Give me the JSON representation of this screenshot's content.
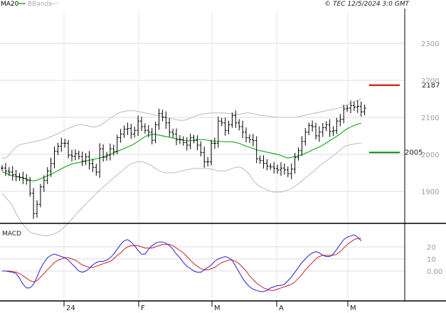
{
  "header": {
    "legend": [
      {
        "label": "MA20",
        "color": "#22aa22"
      },
      {
        "label": "BBands",
        "color": "#aaaaaa"
      }
    ],
    "title": "© TEC 12/5/2024 3:0 GMT"
  },
  "colors": {
    "price": "#000000",
    "ma": "#22aa22",
    "band": "#bbbbbb",
    "macd": "#2222cc",
    "signal": "#cc2222",
    "resistance": "#cc0000",
    "support": "#008800",
    "grid": "#dddddd",
    "axis": "#000000"
  },
  "chart_data": [
    {
      "type": "ohlc",
      "x_labels": [
        "24",
        "F",
        "M",
        "A",
        "M"
      ],
      "y_ticks": [
        "2300",
        "2200",
        "2100",
        "2000",
        "1900"
      ],
      "y_tick_values": [
        2300,
        2200,
        2100,
        2000,
        1900
      ],
      "ylim": [
        1800,
        2400
      ],
      "closes": [
        1963,
        1955,
        1952,
        1945,
        1940,
        1938,
        1935,
        1930,
        1895,
        1840,
        1865,
        1912,
        1930,
        1955,
        1975,
        2008,
        2022,
        2030,
        2030,
        1998,
        1995,
        2002,
        1994,
        1982,
        1993,
        1975,
        1965,
        1952,
        2015,
        1992,
        1998,
        2015,
        2008,
        2045,
        2055,
        2068,
        2070,
        2055,
        2065,
        2090,
        2075,
        2065,
        2060,
        2038,
        2080,
        2110,
        2100,
        2085,
        2060,
        2055,
        2040,
        2040,
        2032,
        2025,
        2045,
        2038,
        2025,
        2005,
        1980,
        1980,
        2030,
        2030,
        2090,
        2085,
        2065,
        2080,
        2105,
        2085,
        2075,
        2060,
        2045,
        2040,
        2037,
        1988,
        1983,
        1976,
        1968,
        1966,
        1962,
        1958,
        1963,
        1958,
        1948,
        1960,
        1992,
        2010,
        2035,
        2060,
        2078,
        2075,
        2050,
        2060,
        2072,
        2080,
        2062,
        2064,
        2090,
        2095,
        2123,
        2125,
        2132,
        2128,
        2130,
        2115,
        2125
      ],
      "ma20": {
        "start": 0,
        "values": [
          1953,
          1950,
          1945,
          1942,
          1940,
          1938,
          1936,
          1933,
          1930,
          1928,
          1930,
          1934,
          1938,
          1942,
          1946,
          1951,
          1956,
          1961,
          1966,
          1970,
          1974,
          1976,
          1978,
          1980,
          1982,
          1984,
          1986,
          1988,
          1990,
          1993,
          1996,
          2000,
          2004,
          2008,
          2012,
          2016,
          2020,
          2024,
          2029,
          2035,
          2042,
          2048,
          2052,
          2054,
          2054,
          2052,
          2050,
          2048,
          2046,
          2044,
          2042,
          2040,
          2038,
          2037,
          2037,
          2038,
          2040,
          2040,
          2040,
          2038,
          2036,
          2036,
          2035,
          2035,
          2034,
          2034,
          2034,
          2032,
          2030,
          2026,
          2022,
          2019,
          2016,
          2012,
          2010,
          2008,
          2006,
          2004,
          2002,
          2000,
          1997,
          1993,
          1990,
          1992,
          1994,
          1996,
          1999,
          2003,
          2007,
          2012,
          2016,
          2020,
          2025,
          2031,
          2037,
          2043,
          2049,
          2055,
          2063,
          2069,
          2074,
          2078,
          2082,
          2084
        ]
      },
      "upper_band": {
        "start": 0,
        "values": [
          1990,
          1990,
          1998,
          2010,
          2020,
          2026,
          2028,
          2030,
          2032,
          2034,
          2036,
          2038,
          2040,
          2044,
          2048,
          2052,
          2056,
          2062,
          2066,
          2070,
          2074,
          2078,
          2080,
          2080,
          2078,
          2076,
          2074,
          2074,
          2078,
          2084,
          2090,
          2098,
          2104,
          2110,
          2114,
          2116,
          2118,
          2118,
          2118,
          2116,
          2114,
          2112,
          2110,
          2108,
          2106,
          2104,
          2102,
          2100,
          2098,
          2096,
          2094,
          2092,
          2092,
          2094,
          2098,
          2102,
          2106,
          2108,
          2110,
          2111,
          2112,
          2112,
          2112,
          2112,
          2112,
          2110,
          2110,
          2108,
          2108,
          2110,
          2112,
          2112,
          2110,
          2108,
          2105,
          2105,
          2104,
          2102,
          2101,
          2100,
          2100,
          2100,
          2100,
          2100,
          2100,
          2102,
          2104,
          2106,
          2108,
          2110,
          2112,
          2114,
          2116,
          2118,
          2120,
          2122,
          2124,
          2126,
          2130,
          2134,
          2138,
          2142,
          2146,
          2150
        ]
      },
      "lower_band": {
        "start": 0,
        "values": [
          1895,
          1884,
          1873,
          1860,
          1840,
          1825,
          1810,
          1800,
          1790,
          1786,
          1784,
          1782,
          1780,
          1780,
          1782,
          1785,
          1790,
          1796,
          1805,
          1815,
          1825,
          1836,
          1846,
          1856,
          1866,
          1875,
          1885,
          1894,
          1903,
          1912,
          1920,
          1928,
          1936,
          1944,
          1952,
          1960,
          1968,
          1974,
          1978,
          1980,
          1980,
          1978,
          1974,
          1968,
          1962,
          1956,
          1952,
          1950,
          1950,
          1950,
          1952,
          1954,
          1956,
          1958,
          1960,
          1962,
          1962,
          1962,
          1962,
          1962,
          1960,
          1958,
          1955,
          1955,
          1955,
          1958,
          1962,
          1965,
          1966,
          1962,
          1955,
          1945,
          1930,
          1920,
          1912,
          1908,
          1904,
          1900,
          1898,
          1898,
          1898,
          1900,
          1904,
          1908,
          1914,
          1920,
          1928,
          1936,
          1944,
          1952,
          1960,
          1968,
          1976,
          1982,
          1990,
          1996,
          2004,
          2012,
          2020,
          2024,
          2026,
          2028,
          2030,
          2030
        ]
      },
      "resistance": 2187,
      "support": 2005
    },
    {
      "type": "line",
      "title": "MACD",
      "y_ticks": [
        "20",
        "10",
        "0.00"
      ],
      "y_tick_values": [
        20,
        10,
        0
      ],
      "ylim": [
        -20,
        37
      ],
      "series": [
        {
          "values": [
            0,
            0,
            -0.5,
            -1,
            -2,
            -6,
            -11,
            -14,
            -14,
            -11,
            -5,
            2,
            7,
            11,
            13,
            14,
            13,
            12,
            11,
            9,
            6,
            3,
            0,
            -1,
            0,
            2,
            5,
            7,
            8,
            8,
            9,
            11,
            14,
            18,
            22,
            25,
            26,
            24,
            21,
            17,
            14,
            14,
            18,
            21,
            23,
            24,
            24,
            23,
            21,
            18,
            14,
            11,
            7,
            4,
            2,
            0,
            -1,
            -1,
            1,
            3,
            5,
            8,
            10,
            11,
            12,
            11,
            9,
            4,
            -1,
            -6,
            -10,
            -13,
            -15,
            -16,
            -17,
            -17,
            -16,
            -14,
            -13,
            -12,
            -12,
            -11,
            -8,
            -5,
            -1,
            3,
            7,
            10,
            13,
            15,
            16,
            15,
            13,
            12,
            12,
            14,
            18,
            22,
            26,
            28,
            29,
            30,
            28,
            25
          ]
        },
        {
          "values": [
            0,
            0,
            0,
            -0.5,
            -1,
            -2,
            -4,
            -6,
            -8,
            -9,
            -8,
            -5,
            -2,
            1,
            4,
            7,
            9,
            10,
            11,
            11,
            10,
            9,
            7,
            5,
            4,
            3,
            3,
            4,
            5,
            6,
            7,
            8,
            10,
            13,
            15,
            18,
            20,
            21,
            21,
            21,
            20,
            19,
            19,
            19,
            20,
            21,
            22,
            22,
            22,
            21,
            19,
            17,
            15,
            12,
            9,
            6,
            4,
            2,
            1,
            1,
            2,
            3,
            5,
            7,
            8,
            9,
            9,
            8,
            6,
            3,
            0,
            -4,
            -7,
            -10,
            -12,
            -14,
            -15,
            -16,
            -16,
            -15,
            -14,
            -13,
            -12,
            -11,
            -9,
            -6,
            -3,
            1,
            4,
            7,
            10,
            12,
            13,
            13,
            13,
            13,
            14,
            16,
            19,
            22,
            24,
            26,
            27,
            27
          ]
        }
      ]
    }
  ]
}
